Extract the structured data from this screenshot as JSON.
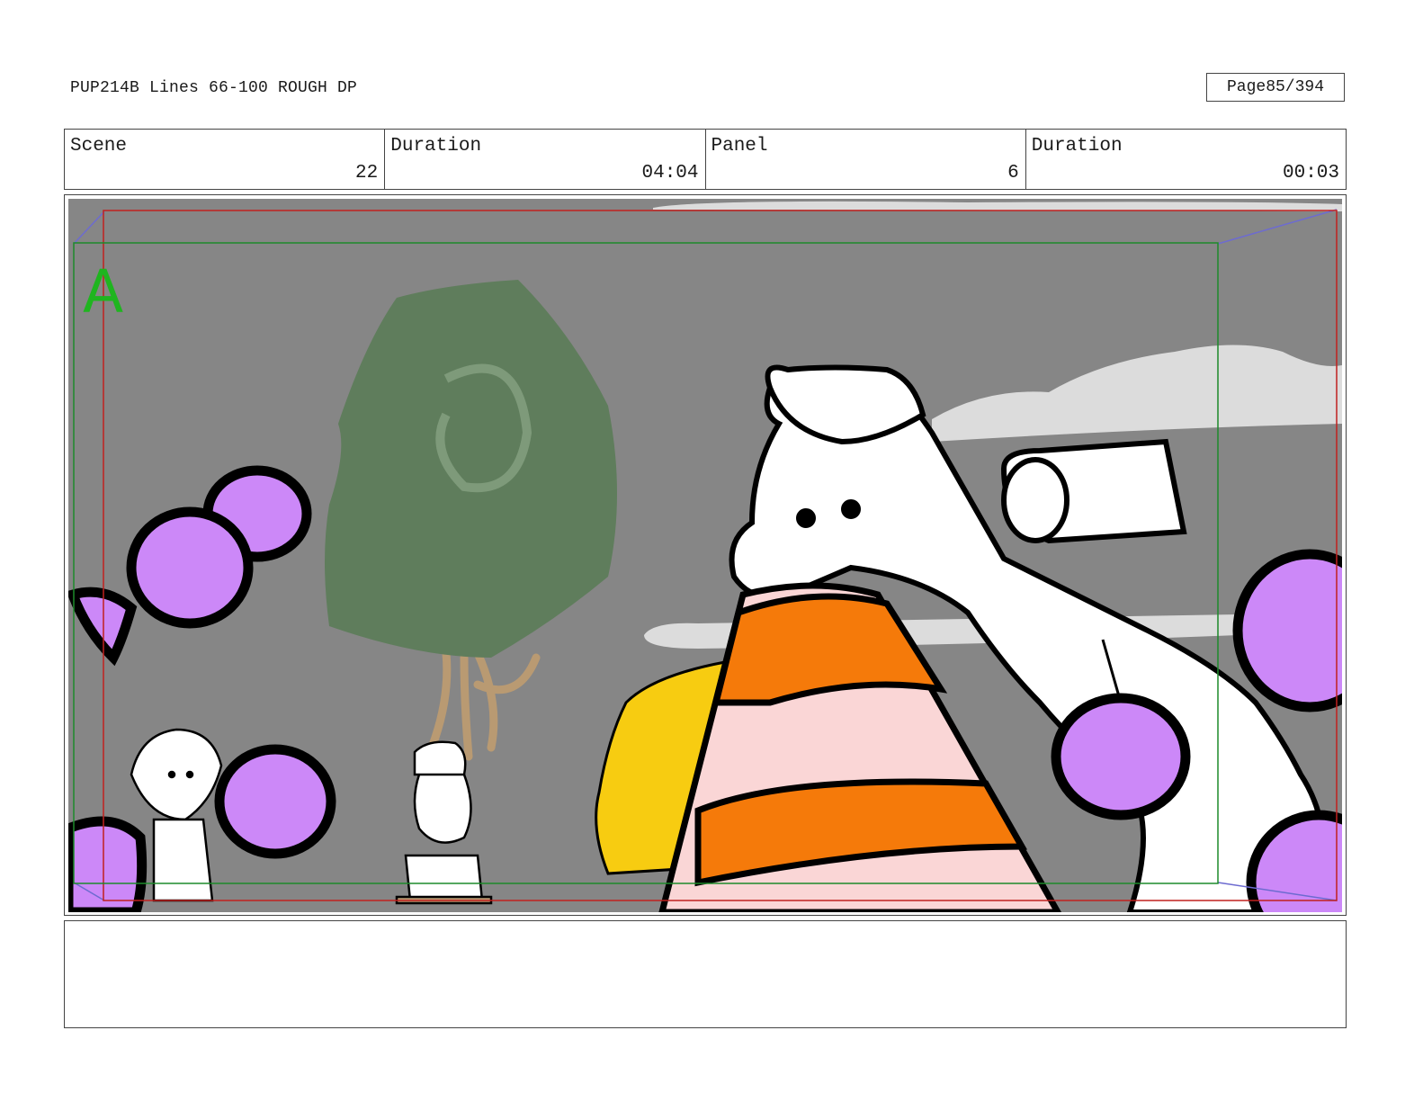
{
  "header": {
    "title": "PUP214B Lines 66-100 ROUGH DP",
    "page_label": "Page",
    "page_value": "85/394"
  },
  "info": {
    "scene_label": "Scene",
    "scene_value": "22",
    "duration_label": "Duration",
    "duration_value": "04:04",
    "panel_label": "Panel",
    "panel_value": "6",
    "panel_duration_label": "Duration",
    "panel_duration_value": "00:03"
  },
  "panel": {
    "field_marker": "A",
    "colors": {
      "background": "#868686",
      "tree_leaves": "#5f7d5c",
      "tree_trunk": "#b99a72",
      "cloud": "#dcdcdc",
      "balloon": "#cc88f8",
      "outline": "#000000",
      "cone_orange": "#f57a0a",
      "cone_pink": "#fad6d6",
      "truck_yellow": "#f7cc11",
      "safe_frame_red": "#c0201e",
      "action_frame_green": "#1d8a2a",
      "camera_move_blue": "#6d6bd0"
    }
  },
  "notes": {
    "text": ""
  }
}
